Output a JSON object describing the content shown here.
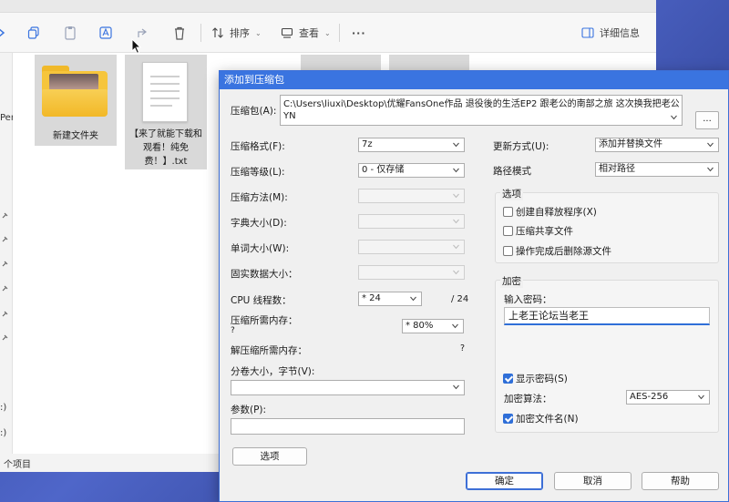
{
  "explorer": {
    "toolbar": {
      "sort_label": "排序",
      "view_label": "查看",
      "more_label": "···",
      "details_label": "详细信息"
    },
    "left_fragments": [
      "Per",
      ":)",
      ":)"
    ],
    "files": [
      {
        "label": "新建文件夹"
      },
      {
        "label": "【来了就能下载和观看！纯免费！】.txt"
      }
    ],
    "status_text": "个项目"
  },
  "dialog": {
    "title": "添加到压缩包",
    "archive_label": "压缩包(A):",
    "archive_path_line1": "C:\\Users\\liuxi\\Desktop\\优耀FansOne作品 退役後的生活EP2 跟老公的南部之旅 这次换我把老公吃掉了～成就感",
    "archive_path_line2": "YN",
    "browse_label": "...",
    "left": {
      "format_label": "压缩格式(F):",
      "format_value": "7z",
      "level_label": "压缩等级(L):",
      "level_value": "0 - 仅存储",
      "method_label": "压缩方法(M):",
      "dict_label": "字典大小(D):",
      "word_label": "单词大小(W):",
      "solid_label": "固实数据大小：",
      "cpu_label": "CPU 线程数：",
      "cpu_value": "* 24",
      "cpu_total": "/ 24",
      "mem_label": "压缩所需内存：",
      "mem_q": "?",
      "mem_value": "* 80%",
      "demem_label": "解压缩所需内存：",
      "demem_q": "?",
      "volume_label": "分卷大小，字节(V):",
      "params_label": "参数(P):",
      "options_button": "选项"
    },
    "right": {
      "update_label": "更新方式(U):",
      "update_value": "添加并替换文件",
      "pathmode_label": "路径模式",
      "pathmode_value": "相对路径",
      "options_title": "选项",
      "opt_sfx": "创建自释放程序(X)",
      "opt_shared": "压缩共享文件",
      "opt_delete": "操作完成后删除源文件",
      "enc_title": "加密",
      "pw_label": "输入密码：",
      "pw_value": "上老王论坛当老王",
      "show_pw": "显示密码(S)",
      "enc_method_label": "加密算法：",
      "enc_method_value": "AES-256",
      "enc_names": "加密文件名(N)"
    },
    "buttons": {
      "ok": "确定",
      "cancel": "取消",
      "help": "帮助"
    }
  }
}
